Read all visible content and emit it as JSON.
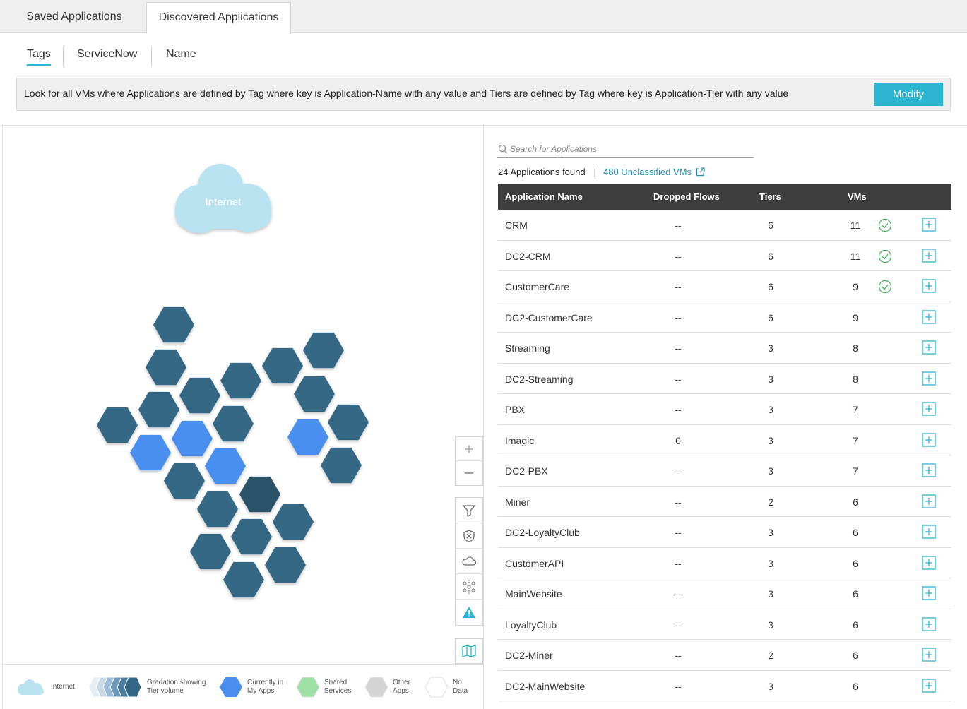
{
  "top_tabs": [
    {
      "label": "Saved Applications",
      "active": false
    },
    {
      "label": "Discovered Applications",
      "active": true
    }
  ],
  "sub_tabs": [
    {
      "label": "Tags",
      "active": true
    },
    {
      "label": "ServiceNow",
      "active": false
    },
    {
      "label": "Name",
      "active": false
    }
  ],
  "query": {
    "text": "Look for all VMs where Applications are defined by Tag where key is Application-Name with any value and Tiers are defined by Tag where key is Application-Tier with any value",
    "modify_label": "Modify"
  },
  "map": {
    "internet_label": "Internet",
    "colors": {
      "tier": "#346785",
      "tier_dark": "#2c526b",
      "my_app": "#4a8ff0",
      "cloud": "#b9e3f0"
    },
    "controls": [
      "plus-icon",
      "minus-icon",
      "filter-icon",
      "shield-x-icon",
      "cloud-icon",
      "network-icon",
      "alert-icon",
      "map-icon"
    ]
  },
  "legend": [
    {
      "label": "Internet"
    },
    {
      "label_line1": "Gradation showing",
      "label_line2": "Tier volume"
    },
    {
      "label_line1": "Currently in",
      "label_line2": "My Apps"
    },
    {
      "label_line1": "Shared",
      "label_line2": "Services"
    },
    {
      "label_line1": "Other",
      "label_line2": "Apps"
    },
    {
      "label_line1": "No",
      "label_line2": "Data"
    }
  ],
  "search": {
    "placeholder": "Search for Applications"
  },
  "summary": {
    "found": "24 Applications found",
    "separator": "|",
    "unclassified": "480 Unclassified VMs"
  },
  "table": {
    "headers": {
      "name": "Application Name",
      "dropped": "Dropped Flows",
      "tiers": "Tiers",
      "vms": "VMs"
    },
    "rows": [
      {
        "name": "CRM",
        "dropped": "--",
        "tiers": "6",
        "vms": "11",
        "checked": true
      },
      {
        "name": "DC2-CRM",
        "dropped": "--",
        "tiers": "6",
        "vms": "11",
        "checked": true
      },
      {
        "name": "CustomerCare",
        "dropped": "--",
        "tiers": "6",
        "vms": "9",
        "checked": true
      },
      {
        "name": "DC2-CustomerCare",
        "dropped": "--",
        "tiers": "6",
        "vms": "9",
        "checked": false
      },
      {
        "name": "Streaming",
        "dropped": "--",
        "tiers": "3",
        "vms": "8",
        "checked": false
      },
      {
        "name": "DC2-Streaming",
        "dropped": "--",
        "tiers": "3",
        "vms": "8",
        "checked": false
      },
      {
        "name": "PBX",
        "dropped": "--",
        "tiers": "3",
        "vms": "7",
        "checked": false
      },
      {
        "name": "Imagic",
        "dropped": "0",
        "tiers": "3",
        "vms": "7",
        "checked": false
      },
      {
        "name": "DC2-PBX",
        "dropped": "--",
        "tiers": "3",
        "vms": "7",
        "checked": false
      },
      {
        "name": "Miner",
        "dropped": "--",
        "tiers": "2",
        "vms": "6",
        "checked": false
      },
      {
        "name": "DC2-LoyaltyClub",
        "dropped": "--",
        "tiers": "3",
        "vms": "6",
        "checked": false
      },
      {
        "name": "CustomerAPI",
        "dropped": "--",
        "tiers": "3",
        "vms": "6",
        "checked": false
      },
      {
        "name": "MainWebsite",
        "dropped": "--",
        "tiers": "3",
        "vms": "6",
        "checked": false
      },
      {
        "name": "LoyaltyClub",
        "dropped": "--",
        "tiers": "3",
        "vms": "6",
        "checked": false
      },
      {
        "name": "DC2-Miner",
        "dropped": "--",
        "tiers": "2",
        "vms": "6",
        "checked": false
      },
      {
        "name": "DC2-MainWebsite",
        "dropped": "--",
        "tiers": "3",
        "vms": "6",
        "checked": false
      }
    ]
  }
}
